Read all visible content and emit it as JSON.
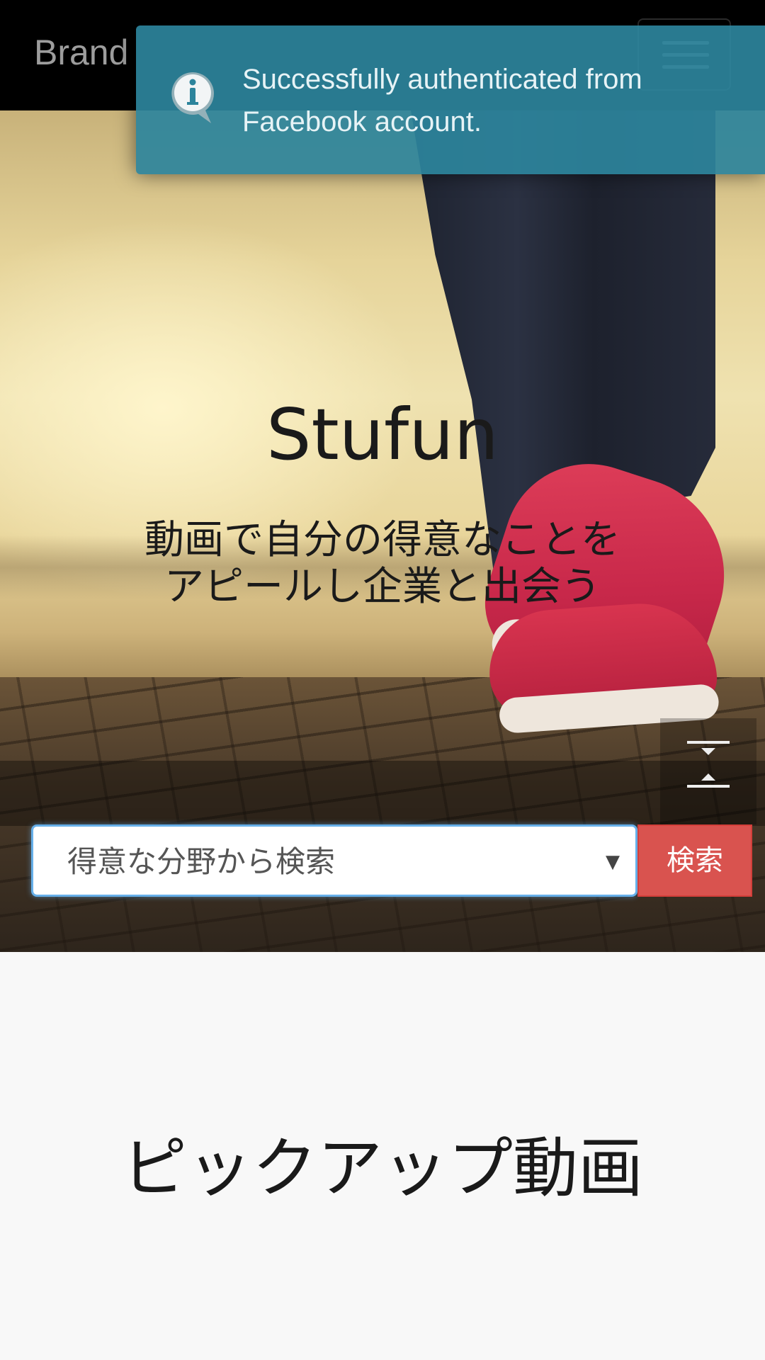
{
  "navbar": {
    "brand": "Brand",
    "menu_icon": "hamburger-menu-icon"
  },
  "toast": {
    "icon": "info-speech-bubble-icon",
    "message": "Successfully authenticated from Facebook account."
  },
  "hero": {
    "title": "Stufun",
    "subtitle_line1": "動画で自分の得意なことを",
    "subtitle_line2": "アピールし企業と出会う",
    "collapse_icon": "collapse-vertical-icon"
  },
  "search": {
    "select_value": "得意な分野から検索",
    "dropdown_icon": "caret-down-icon",
    "button_label": "検索"
  },
  "pickup": {
    "title": "ピックアップ動画"
  },
  "colors": {
    "navbar_bg": "#000000",
    "toast_bg": "#2c849c",
    "search_button": "#d9534f",
    "focus_border": "#66afe9"
  }
}
